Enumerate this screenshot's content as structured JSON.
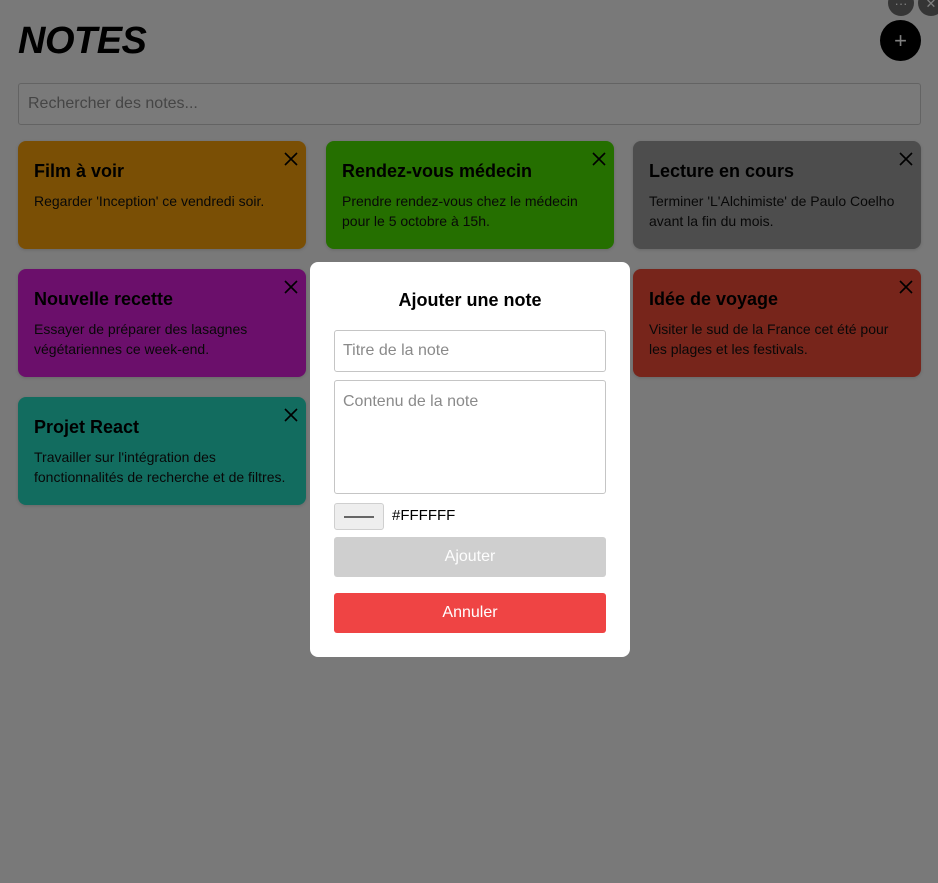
{
  "header": {
    "title": "NOTES",
    "add_icon": "plus-icon",
    "add_glyph": "+"
  },
  "window_controls": {
    "more_glyph": "···",
    "close_glyph": "✕"
  },
  "search": {
    "placeholder": "Rechercher des notes..."
  },
  "notes": [
    {
      "title": "Film à voir",
      "text": "Regarder 'Inception' ce vendredi soir.",
      "color": "#f59e0b"
    },
    {
      "title": "Rendez-vous médecin",
      "text": "Prendre rendez-vous chez le médecin pour le 5 octobre à 15h.",
      "color": "#4ade00"
    },
    {
      "title": "Lecture en cours",
      "text": "Terminer 'L'Alchimiste' de Paulo Coelho avant la fin du mois.",
      "color": "#9a9a9a"
    },
    {
      "title": "Nouvelle recette",
      "text": "Essayer de préparer des lasagnes végétariennes ce week-end.",
      "color": "#d61fd6"
    },
    {
      "title": "Idée de voyage",
      "text": "Visiter le sud de la France cet été pour les plages et les festivals.",
      "color": "#ef4a36"
    },
    {
      "title": "Projet React",
      "text": "Travailler sur l'intégration des fonctionnalités de recherche et de filtres.",
      "color": "#24d9bf"
    }
  ],
  "modal": {
    "title": "Ajouter une note",
    "title_placeholder": "Titre de la note",
    "content_placeholder": "Contenu de la note",
    "color_value": "#FFFFFF",
    "add_label": "Ajouter",
    "cancel_label": "Annuler"
  },
  "colors": {
    "accent_cancel": "#ef4444",
    "disabled_button": "#cfcfcf",
    "overlay": "rgba(0,0,0,0.5)"
  }
}
